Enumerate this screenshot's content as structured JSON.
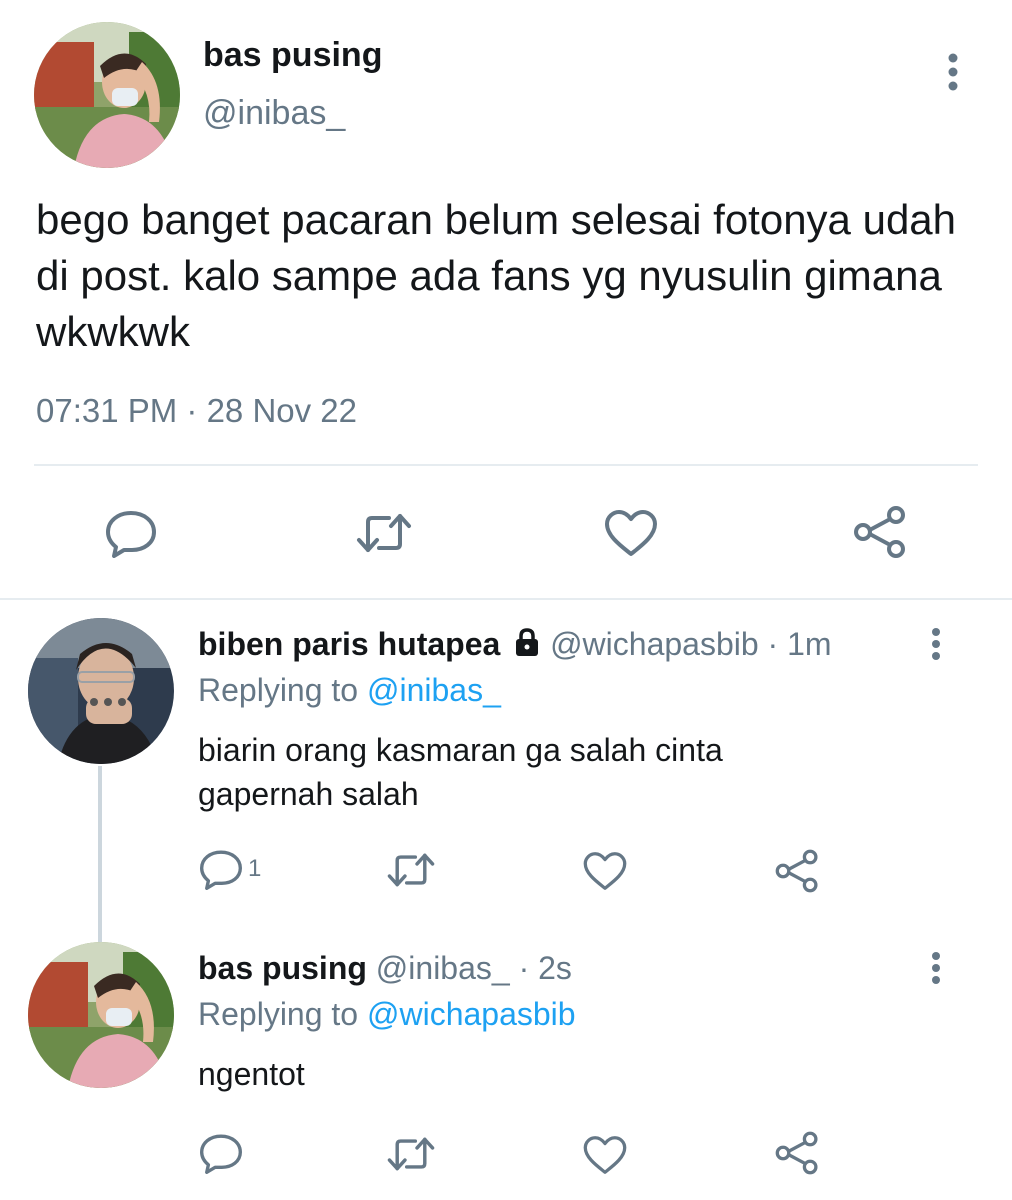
{
  "main_tweet": {
    "name": "bas pusing",
    "handle": "@inibas_",
    "text": "bego banget pacaran belum selesai fotonya udah di post. kalo sampe ada fans yg nyusulin gimana wkwkwk",
    "timestamp": "07:31 PM · 28 Nov 22",
    "actions": [
      "reply-icon",
      "retweet-icon",
      "like-icon",
      "share-icon"
    ]
  },
  "replies": [
    {
      "name": "biben paris hutapea",
      "lock_icon": "lock-icon",
      "handle": "@wichapasbib",
      "time": "· 1m",
      "replying_prefix": "Replying to ",
      "replying_to": "@inibas_",
      "text_line1": "biarin orang kasmaran ga salah cinta",
      "text_line2": "gapernah salah",
      "reply_count": "1"
    },
    {
      "name": "bas pusing",
      "handle": "@inibas_",
      "time": "· 2s",
      "replying_prefix": "Replying to ",
      "replying_to": "@wichapasbib",
      "text_line1": "ngentot",
      "reply_count": ""
    }
  ],
  "colors": {
    "text": "#14171a",
    "secondary": "#657786",
    "link": "#1da1f2",
    "divider": "#e6ecf0"
  }
}
